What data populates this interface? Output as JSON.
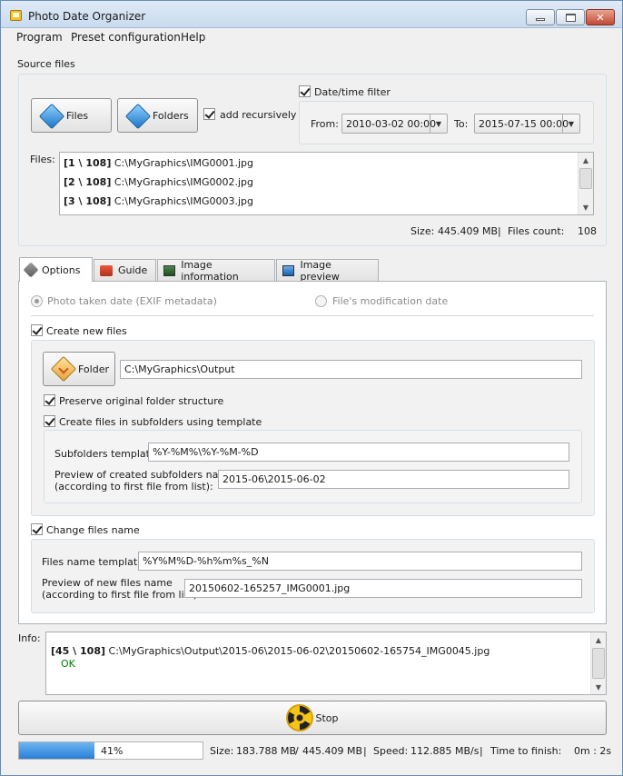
{
  "window": {
    "title": "Photo Date Organizer"
  },
  "menu": [
    "Program",
    "Preset configuration",
    "Help"
  ],
  "source": {
    "section_label": "Source files",
    "files_button": "Files",
    "folders_button": "Folders",
    "add_recursively": {
      "label": "add recursively",
      "checked": true
    },
    "date_filter": {
      "label": "Date/time filter",
      "checked": true,
      "from_label": "From:",
      "from_value": "2010-03-02 00:00",
      "to_label": "To:",
      "to_value": "2015-07-15 00:00"
    },
    "files_label": "Files:",
    "files": [
      {
        "index": "[1 \\ 108]",
        "path": "C:\\MyGraphics\\IMG0001.jpg"
      },
      {
        "index": "[2 \\ 108]",
        "path": "C:\\MyGraphics\\IMG0002.jpg"
      },
      {
        "index": "[3 \\ 108]",
        "path": "C:\\MyGraphics\\IMG0003.jpg"
      }
    ],
    "size_label": "Size:",
    "size_value": "445.409 MB",
    "separator": "|",
    "count_label": "Files count:",
    "count_value": "108"
  },
  "tabs": [
    {
      "label": "Options",
      "active": true
    },
    {
      "label": "Guide",
      "active": false
    },
    {
      "label": "Image information",
      "active": false
    },
    {
      "label": "Image preview",
      "active": false
    }
  ],
  "options": {
    "radio_exif": {
      "label": "Photo taken date (EXIF metadata)",
      "checked": true
    },
    "radio_mod": {
      "label": "File's modification date",
      "checked": false
    },
    "create_new_files": {
      "label": "Create new files",
      "checked": true
    },
    "folder_button": "Folder",
    "output_path": "C:\\MyGraphics\\Output",
    "preserve_structure": {
      "label": "Preserve original folder structure",
      "checked": true
    },
    "create_subfolders": {
      "label": "Create files in subfolders using template",
      "checked": true
    },
    "subfolders_template_label": "Subfolders template",
    "subfolders_template_value": "%Y-%M%\\%Y-%M-%D",
    "subfolders_preview_label_1": "Preview of created subfolders name",
    "subfolders_preview_label_2": "(according to first file from list):",
    "subfolders_preview_value": "2015-06\\2015-06-02",
    "change_names": {
      "label": "Change files name",
      "checked": true
    },
    "names_template_label": "Files name template:",
    "names_template_value": "%Y%M%D-%h%m%s_%N",
    "names_preview_label_1": "Preview of new files name",
    "names_preview_label_2": "(according to first file from list):",
    "names_preview_value": "20150602-165257_IMG0001.jpg"
  },
  "info": {
    "label": "Info:",
    "line_index": "[45 \\ 108]",
    "line_path": "C:\\MyGraphics\\Output\\2015-06\\2015-06-02\\20150602-165754_IMG0045.jpg",
    "status": "OK",
    "status_color": "#008000"
  },
  "stop_button": "Stop",
  "progress": {
    "percent_label": "41%",
    "fraction": 0.41,
    "size_label": "Size:",
    "size_done": "183.788 MB",
    "size_sep": "/",
    "size_total": "445.409 MB",
    "sep1": "|",
    "speed_label": "Speed:",
    "speed_value": "112.885 MB/s",
    "sep2": "|",
    "time_label": "Time to finish:",
    "time_value": "0m : 2s",
    "bar_color": "#2a7fd6"
  }
}
